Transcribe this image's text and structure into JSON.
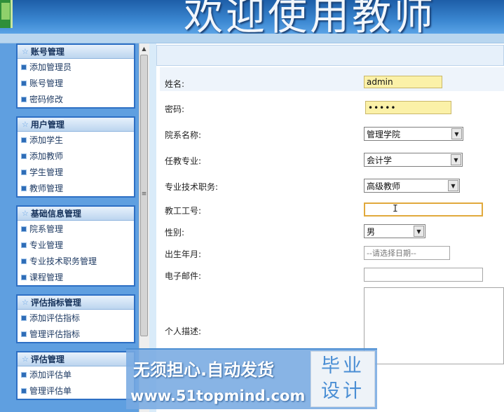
{
  "header": {
    "title": "欢迎使用教师"
  },
  "sidebar": {
    "groups": [
      {
        "title": "账号管理",
        "items": [
          "添加管理员",
          "账号管理",
          "密码修改"
        ]
      },
      {
        "title": "用户管理",
        "items": [
          "添加学生",
          "添加教师",
          "学生管理",
          "教师管理"
        ]
      },
      {
        "title": "基础信息管理",
        "items": [
          "院系管理",
          "专业管理",
          "专业技术职务管理",
          "课程管理"
        ]
      },
      {
        "title": "评估指标管理",
        "items": [
          "添加评估指标",
          "管理评估指标"
        ]
      },
      {
        "title": "评估管理",
        "items": [
          "添加评估单",
          "管理评估单"
        ]
      }
    ]
  },
  "form": {
    "name_label": "姓名:",
    "name_value": "admin",
    "password_label": "密码:",
    "password_value": "•••••",
    "department_label": "院系名称:",
    "department_value": "管理学院",
    "major_label": "任教专业:",
    "major_value": "会计学",
    "title_label": "专业技术职务:",
    "title_value": "高级教师",
    "staff_id_label": "教工工号:",
    "staff_id_value": "",
    "gender_label": "性别:",
    "gender_value": "男",
    "birth_label": "出生年月:",
    "birth_placeholder": "--请选择日期--",
    "email_label": "电子邮件:",
    "email_value": "",
    "bio_label": "个人描述:"
  },
  "watermark": {
    "line1": "无须担心.自动发货",
    "line2": "www.51topmind.com",
    "badge_line1": "毕业",
    "badge_line2": "设计"
  },
  "icons": {
    "group_star": "star-icon",
    "item_bullet": "square-bullet-icon",
    "dropdown": "chevron-down-icon",
    "scroll_up": "arrow-up-icon",
    "text_cursor": "i-beam-cursor-icon"
  },
  "colors": {
    "sidebar_bg": "#5f9fe0",
    "group_border": "#2d6fc4",
    "field_highlight": "#fbf1a8",
    "focus_border": "#e1a93c"
  }
}
